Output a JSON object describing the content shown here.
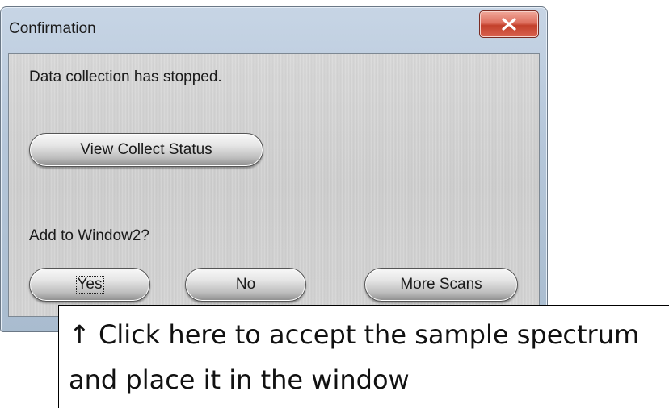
{
  "dialog": {
    "title": "Confirmation",
    "message": "Data collection has stopped.",
    "view_button_label": "View Collect Status",
    "question": "Add to Window2?",
    "buttons": {
      "yes": "Yes",
      "no": "No",
      "more": "More Scans"
    },
    "close_icon": "close-icon"
  },
  "callout": {
    "text": "↑ Click here to accept the sample spectrum and place it in the window"
  }
}
